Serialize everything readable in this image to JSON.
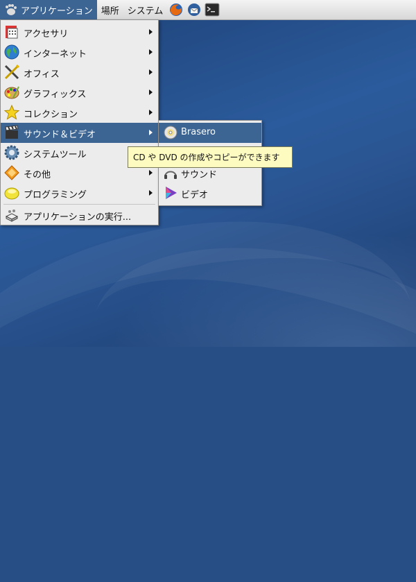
{
  "panel": {
    "applications_label": "アプリケーション",
    "places_label": "場所",
    "system_label": "システム",
    "launchers": [
      "firefox-icon",
      "thunderbird-icon",
      "terminal-icon"
    ]
  },
  "apps_menu": {
    "items": [
      {
        "label": "アクセサリ",
        "icon": "accessories-icon"
      },
      {
        "label": "インターネット",
        "icon": "globe-icon"
      },
      {
        "label": "オフィス",
        "icon": "office-icon"
      },
      {
        "label": "グラフィックス",
        "icon": "palette-icon"
      },
      {
        "label": "コレクション",
        "icon": "star-icon"
      },
      {
        "label": "サウンド＆ビデオ",
        "icon": "clapper-icon"
      },
      {
        "label": "システムツール",
        "icon": "system-tools-icon"
      },
      {
        "label": "その他",
        "icon": "other-icon"
      },
      {
        "label": "プログラミング",
        "icon": "programming-icon"
      }
    ],
    "run_label": "アプリケーションの実行..."
  },
  "submenu": {
    "items": [
      {
        "label": "Brasero",
        "icon": "disc-icon"
      },
      {
        "label": "サウンド",
        "icon": "sound-icon"
      },
      {
        "label": "ビデオ",
        "icon": "video-icon"
      }
    ]
  },
  "tooltip": {
    "text": "CD や DVD の作成やコピーができます"
  },
  "colors": {
    "highlight": "#3c6593",
    "menu_bg": "#ececec",
    "tooltip_bg": "#fdfbc0",
    "desktop": "#274f85"
  }
}
